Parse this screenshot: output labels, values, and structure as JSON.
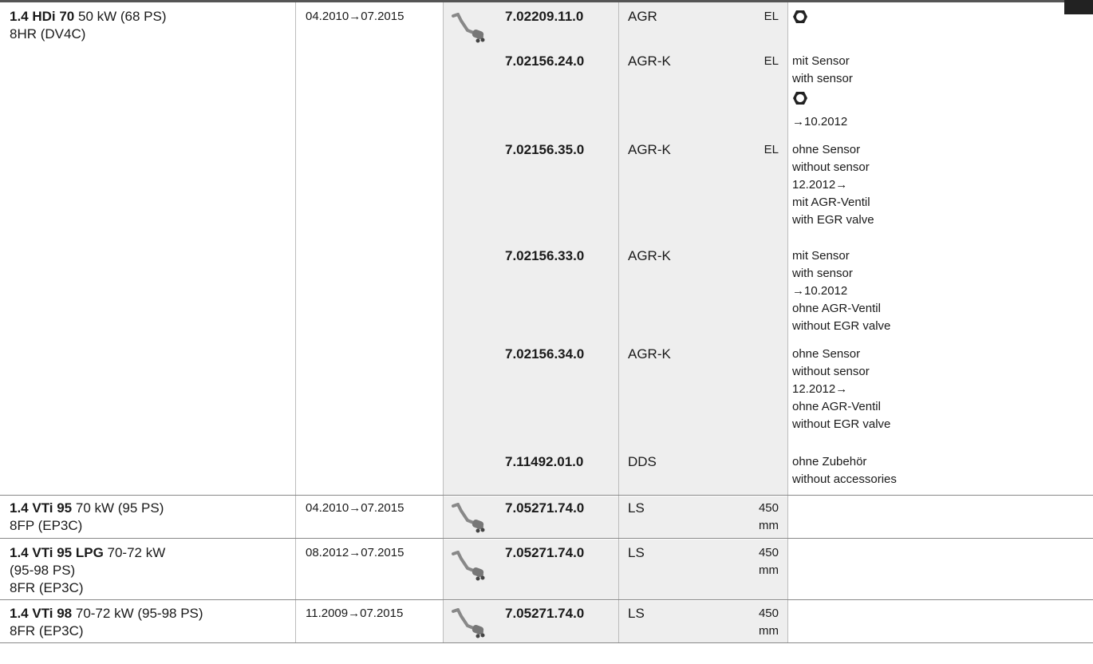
{
  "rows": [
    {
      "engine_bold": "1.4 HDi 70",
      "engine_rest": " 50 kW (68 PS)",
      "engine_lines": [
        "8HR (DV4C)"
      ],
      "period": "04.2010→07.2015",
      "icon": "exhaust-pipe-icon",
      "parts": [
        {
          "number": "7.02209.11.0",
          "type": "AGR",
          "note": "EL",
          "remarks": [
            "⬡"
          ]
        },
        {
          "number": "7.02156.24.0",
          "type": "AGR-K",
          "note": "EL",
          "remarks": [
            "mit Sensor",
            "with sensor",
            "⬡",
            "→10.2012"
          ]
        },
        {
          "number": "7.02156.35.0",
          "type": "AGR-K",
          "note": "EL",
          "remarks": [
            "ohne Sensor",
            "without sensor",
            "12.2012→",
            "mit AGR-Ventil",
            "with EGR valve"
          ]
        },
        {
          "number": "7.02156.33.0",
          "type": "AGR-K",
          "note": "",
          "remarks": [
            "mit Sensor",
            "with sensor",
            "→10.2012",
            "ohne AGR-Ventil",
            "without EGR valve"
          ]
        },
        {
          "number": "7.02156.34.0",
          "type": "AGR-K",
          "note": "",
          "remarks": [
            "ohne Sensor",
            "without sensor",
            "12.2012→",
            "ohne AGR-Ventil",
            "without EGR valve"
          ]
        },
        {
          "number": "7.11492.01.0",
          "type": "DDS",
          "note": "",
          "remarks": [
            "ohne Zubehör",
            "without accessories"
          ]
        }
      ]
    },
    {
      "engine_bold": "1.4 VTi 95",
      "engine_rest": " 70 kW (95 PS)",
      "engine_lines": [
        "8FP (EP3C)"
      ],
      "period": "04.2010→07.2015",
      "icon": "exhaust-pipe-icon",
      "parts": [
        {
          "number": "7.05271.74.0",
          "type": "LS",
          "note": "450",
          "note2": "mm"
        }
      ]
    },
    {
      "engine_bold": "1.4 VTi 95 LPG",
      "engine_rest": " 70-72 kW",
      "engine_lines": [
        "(95-98 PS)",
        "8FR (EP3C)"
      ],
      "period": "08.2012→07.2015",
      "icon": "exhaust-pipe-icon",
      "parts": [
        {
          "number": "7.05271.74.0",
          "type": "LS",
          "note": "450",
          "note2": "mm"
        }
      ]
    },
    {
      "engine_bold": "1.4 VTi 98",
      "engine_rest": " 70-72 kW (95-98 PS)",
      "engine_lines": [
        "8FR (EP3C)"
      ],
      "period": "11.2009→07.2015",
      "icon": "exhaust-pipe-icon",
      "parts": [
        {
          "number": "7.05271.74.0",
          "type": "LS",
          "note": "450",
          "note2": "mm"
        }
      ]
    }
  ]
}
